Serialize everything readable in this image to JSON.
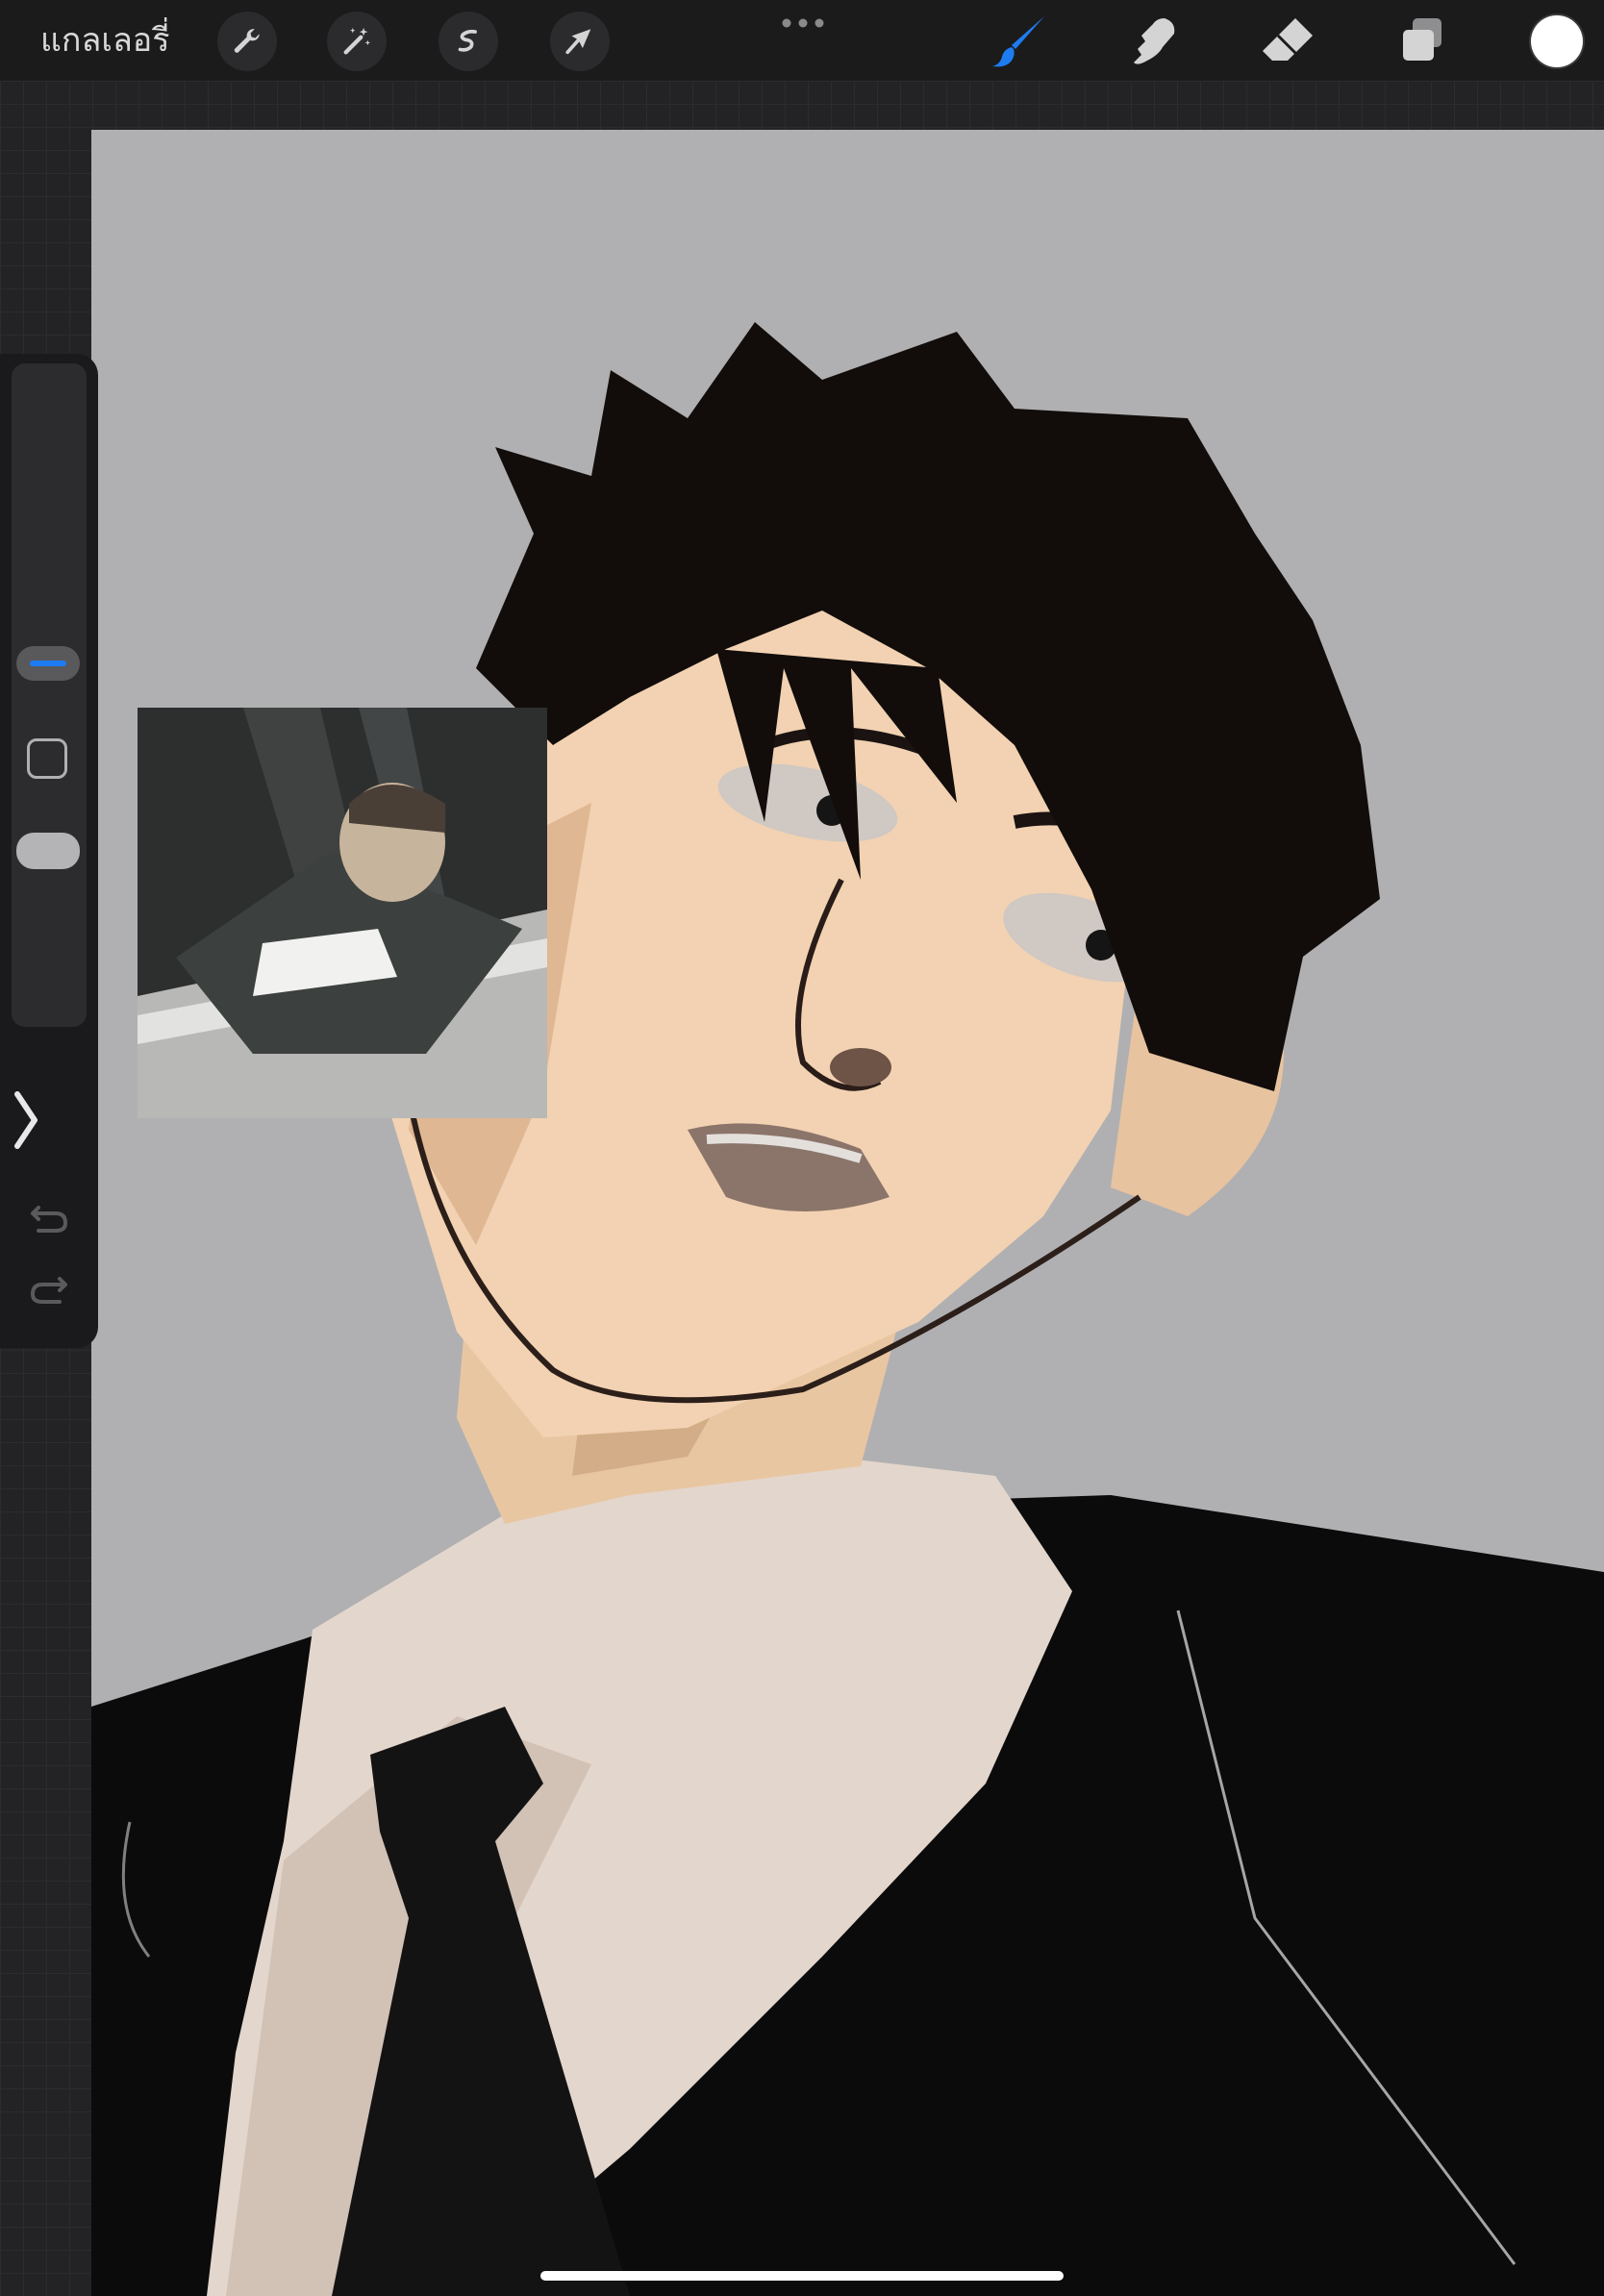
{
  "toolbar": {
    "gallery_label": "แกลเลอรี่",
    "left_tools": [
      "wrench-icon",
      "magic-wand-icon",
      "selection-icon",
      "transform-arrow-icon"
    ],
    "right_tools": [
      "brush-icon",
      "smudge-icon",
      "eraser-icon",
      "layers-icon"
    ],
    "active_tool": "brush-icon",
    "active_color": "#1e7cf2",
    "current_color": "#ffffff"
  },
  "sidebar": {
    "brush_size_level": 0.45,
    "opacity_level": 0.2,
    "controls": [
      "brush-size-slider",
      "modify-button",
      "opacity-slider",
      "undo-icon",
      "redo-icon"
    ]
  },
  "canvas": {
    "background_color": "#b0b0b2"
  }
}
